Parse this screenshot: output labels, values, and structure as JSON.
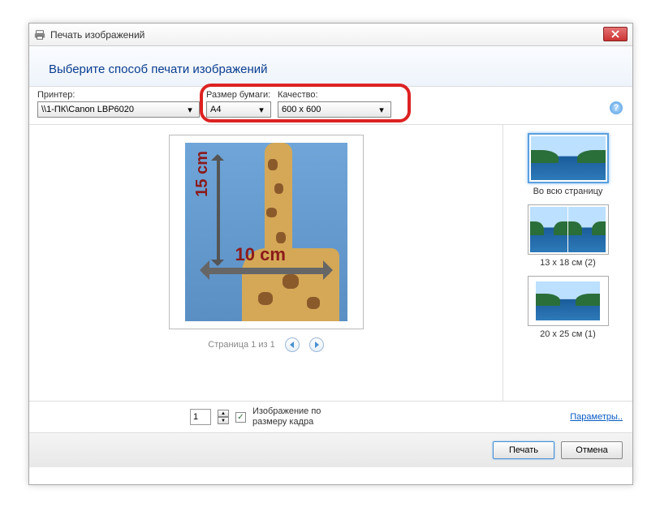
{
  "titlebar": {
    "title": "Печать изображений"
  },
  "header": {
    "heading": "Выберите способ печати изображений"
  },
  "toolbar": {
    "printer_label": "Принтер:",
    "printer_value": "\\\\1-ПК\\Canon LBP6020",
    "paper_label": "Размер бумаги:",
    "paper_value": "A4",
    "quality_label": "Качество:",
    "quality_value": "600 x 600"
  },
  "preview": {
    "dim_vertical": "15 cm",
    "dim_horizontal": "10 cm",
    "pager_text": "Страница 1 из 1"
  },
  "templates": [
    {
      "label": "Во всю страницу"
    },
    {
      "label": "13 x 18 см (2)"
    },
    {
      "label": "20 x 25 см (1)"
    }
  ],
  "options": {
    "copies_value": "1",
    "fit_label": "Изображение по размеру кадра",
    "params_link": "Параметры.."
  },
  "footer": {
    "print": "Печать",
    "cancel": "Отмена"
  }
}
